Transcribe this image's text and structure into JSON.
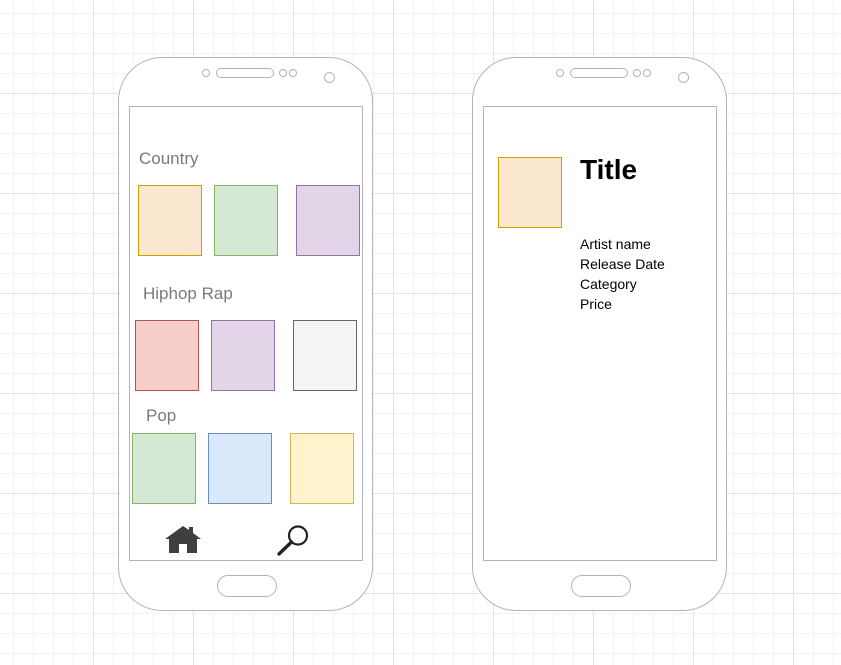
{
  "colors": {
    "outline": "#b3b3b3",
    "label": "#7a7a7a",
    "tiles": {
      "orange": {
        "fill": "#fbe6cf",
        "stroke": "#d79b00"
      },
      "green": {
        "fill": "#d5e8d4",
        "stroke": "#82b366"
      },
      "purple": {
        "fill": "#e1d5e7",
        "stroke": "#9673a6"
      },
      "red": {
        "fill": "#f8cecc",
        "stroke": "#b85450"
      },
      "gray": {
        "fill": "#f5f5f5",
        "stroke": "#666666"
      },
      "blue": {
        "fill": "#dae8fc",
        "stroke": "#6c8ebf"
      },
      "yellow": {
        "fill": "#fff2cc",
        "stroke": "#d6b656"
      }
    }
  },
  "browse_screen": {
    "sections": [
      {
        "label": "Country",
        "tiles": [
          "orange",
          "green",
          "purple"
        ]
      },
      {
        "label": "Hiphop Rap",
        "tiles": [
          "red",
          "purple",
          "gray"
        ]
      },
      {
        "label": "Pop",
        "tiles": [
          "green",
          "blue",
          "yellow"
        ]
      }
    ],
    "nav": [
      {
        "icon": "home-icon"
      },
      {
        "icon": "search-icon"
      }
    ]
  },
  "detail_screen": {
    "cover_tile": "orange",
    "title": "Title",
    "details": [
      "Artist name",
      "Release Date",
      "Category",
      "Price"
    ]
  }
}
